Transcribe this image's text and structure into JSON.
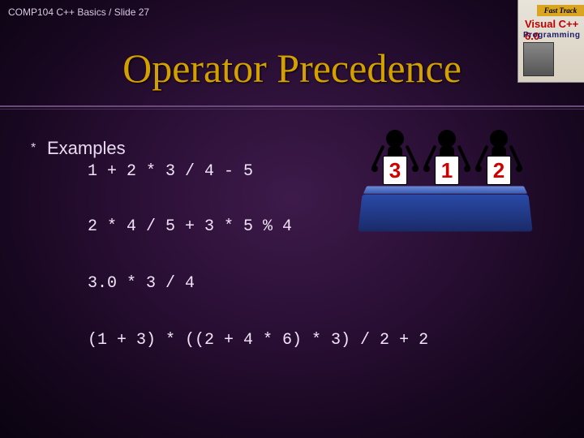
{
  "header": "COMP104 C++ Basics / Slide 27",
  "title": "Operator Precedence",
  "bullet_glyph": "*",
  "bullet_label": "Examples",
  "code": {
    "line1": "1 + 2 * 3 / 4 - 5",
    "line2": "2 * 4 / 5 + 3 * 5 % 4",
    "line3": "3.0 * 3 / 4",
    "line4": "(1 + 3) * ((2 + 4 * 6) * 3) / 2 + 2"
  },
  "book": {
    "banner": "Fast Track",
    "line1": "Visual C++ 6.0",
    "line2": "Programming"
  },
  "judges": {
    "scores": [
      "3",
      "1",
      "2"
    ]
  }
}
